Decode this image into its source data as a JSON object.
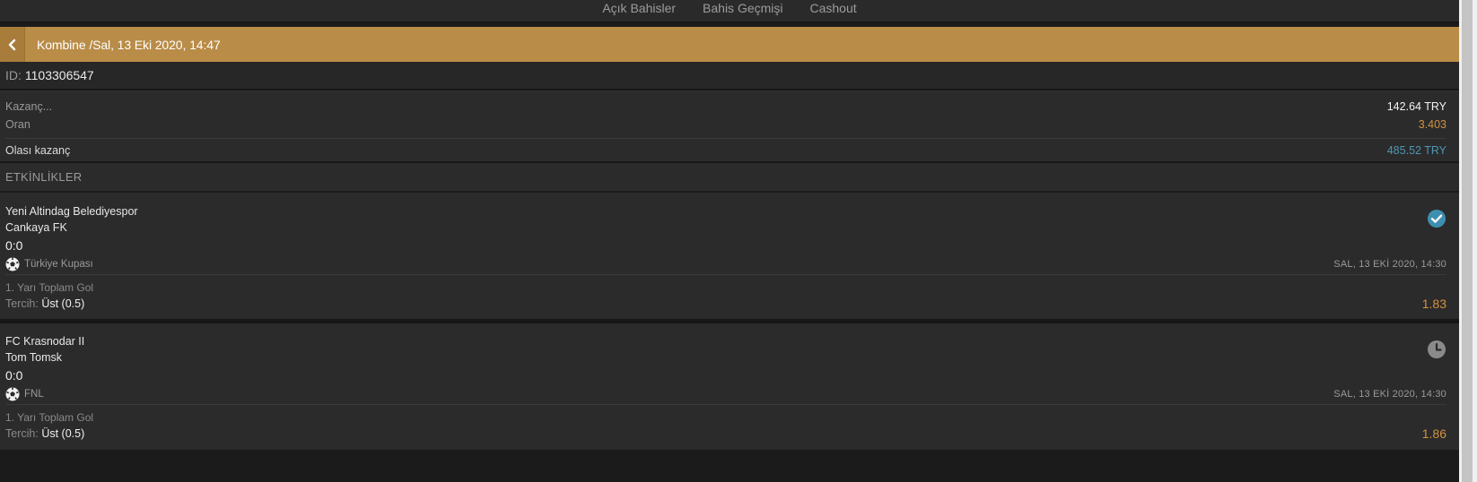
{
  "nav": {
    "tabs": [
      "Açık Bahisler",
      "Bahis Geçmişi",
      "Cashout"
    ]
  },
  "header": {
    "title": "Kombine /Sal, 13 Eki 2020, 14:47"
  },
  "bet": {
    "id_label": "ID:",
    "id_value": "1103306547"
  },
  "summary": {
    "stake_label": "Kazanç...",
    "stake_value": "142.64 TRY",
    "odds_label": "Oran",
    "odds_value": "3.403",
    "potential_label": "Olası kazanç",
    "potential_value": "485.52 TRY"
  },
  "events_title": "ETKİNLİKLER",
  "events": [
    {
      "home": "Yeni Altindag Belediyespor",
      "away": "Cankaya FK",
      "score": "0:0",
      "competition": "Türkiye Kupası",
      "date": "SAL, 13 EKİ 2020, 14:30",
      "market": "1. Yarı Toplam Gol",
      "pick_label": "Tercih:",
      "pick_value": "Üst (0.5)",
      "odds": "1.83",
      "status_icon": "check-circle-icon"
    },
    {
      "home": "FC Krasnodar II",
      "away": "Tom Tomsk",
      "score": "0:0",
      "competition": "FNL",
      "date": "SAL, 13 EKİ 2020, 14:30",
      "market": "1. Yarı Toplam Gol",
      "pick_label": "Tercih:",
      "pick_value": "Üst (0.5)",
      "odds": "1.86",
      "status_icon": "clock-icon"
    }
  ],
  "colors": {
    "accent": "#b98c47",
    "odds": "#d3913f",
    "potential": "#4e96b3",
    "won": "#3d8fb0",
    "pending": "#8a8a8a"
  }
}
